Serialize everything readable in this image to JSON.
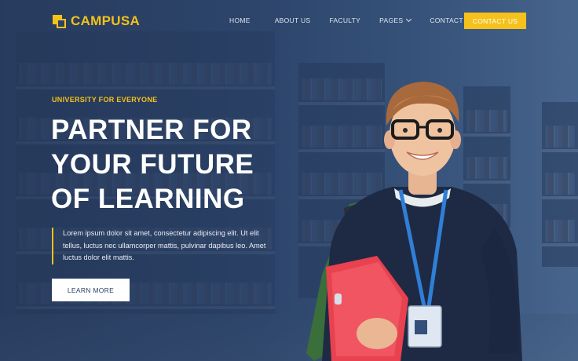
{
  "brand": {
    "name": "CAMPUSA",
    "color": "#f4c21a"
  },
  "nav": {
    "items": [
      {
        "label": "HOME"
      },
      {
        "label": "ABOUT US"
      },
      {
        "label": "FACULTY"
      },
      {
        "label": "PAGES",
        "has_dropdown": true
      },
      {
        "label": "CONTACT US"
      }
    ],
    "cta_label": "CONTACT US"
  },
  "hero": {
    "eyebrow": "UNIVERSITY FOR EVERYONE",
    "headline_lines": [
      "PARTNER FOR",
      "YOUR FUTURE",
      "OF LEARNING"
    ],
    "description_lines": [
      "Lorem ipsum dolor sit amet, consectetur adipiscing elit. Ut elit",
      "tellus, luctus nec ullamcorper mattis, pulvinar dapibus leo. Amet",
      "luctus dolor elit mattis."
    ],
    "button_label": "LEARN MORE"
  },
  "colors": {
    "accent": "#f4c21a",
    "background": "#2b4266",
    "text": "#ffffff"
  },
  "icons": [
    "logo-mark-icon",
    "chevron-down-icon"
  ]
}
